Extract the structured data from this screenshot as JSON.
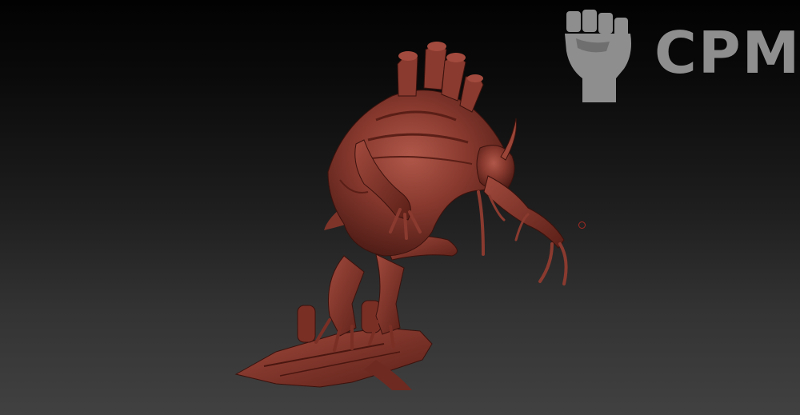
{
  "viewport": {
    "background_top": "#020202",
    "background_bottom": "#414141",
    "model_color": "#8a3a2f"
  },
  "watermark": {
    "text": "CPM",
    "icon": "raised-fist-icon",
    "color": "#8e8e8e"
  },
  "cursor": {
    "icon": "brush-circle-icon",
    "color": "#a52a22"
  }
}
